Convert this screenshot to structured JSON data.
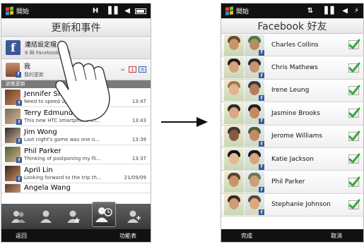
{
  "screen1": {
    "status": {
      "start_label": "開始"
    },
    "title": "更新和事件",
    "facebook_row": {
      "title": "連結設定檔",
      "subtitle": "8 與 Facebook 連結"
    },
    "me_row": {
      "name": "我",
      "subtitle": "我的更新"
    },
    "section_label": "狀態更新",
    "feed": [
      {
        "name": "Jennifer Singer",
        "message": "Need to speed up to catch u...",
        "time": "13:47"
      },
      {
        "name": "Terry Edmund",
        "message": "This new HTC smartphone th...",
        "time": "13:43"
      },
      {
        "name": "Jim Wong",
        "message": "Last night's game was one o...",
        "time": "13:39"
      },
      {
        "name": "Phil Parker",
        "message": "Thinking of postponing my fli...",
        "time": "13:37"
      },
      {
        "name": "April Lin",
        "message": "Looking forward to the trip th...",
        "time": "21/09/09"
      },
      {
        "name": "Angela Wang",
        "message": "",
        "time": ""
      }
    ],
    "bottom": {
      "left": "返回",
      "right": "功能表"
    }
  },
  "screen2": {
    "status": {
      "start_label": "開始"
    },
    "title": "Facebook 好友",
    "friends": [
      {
        "name": "Charles Collins",
        "checked": true
      },
      {
        "name": "Chris Mathews",
        "checked": true
      },
      {
        "name": "Irene Leung",
        "checked": true
      },
      {
        "name": "Jasmine Brooks",
        "checked": true
      },
      {
        "name": "Jerome Williams",
        "checked": true
      },
      {
        "name": "Katie Jackson",
        "checked": true
      },
      {
        "name": "Phil Parker",
        "checked": true
      },
      {
        "name": "Stephanie Johnson",
        "checked": true
      }
    ],
    "bottom": {
      "left": "完成",
      "right": "取消"
    }
  },
  "colors": {
    "facebook_blue": "#3b5998",
    "check_green": "#3ca83a",
    "status_bar": "#111111"
  }
}
